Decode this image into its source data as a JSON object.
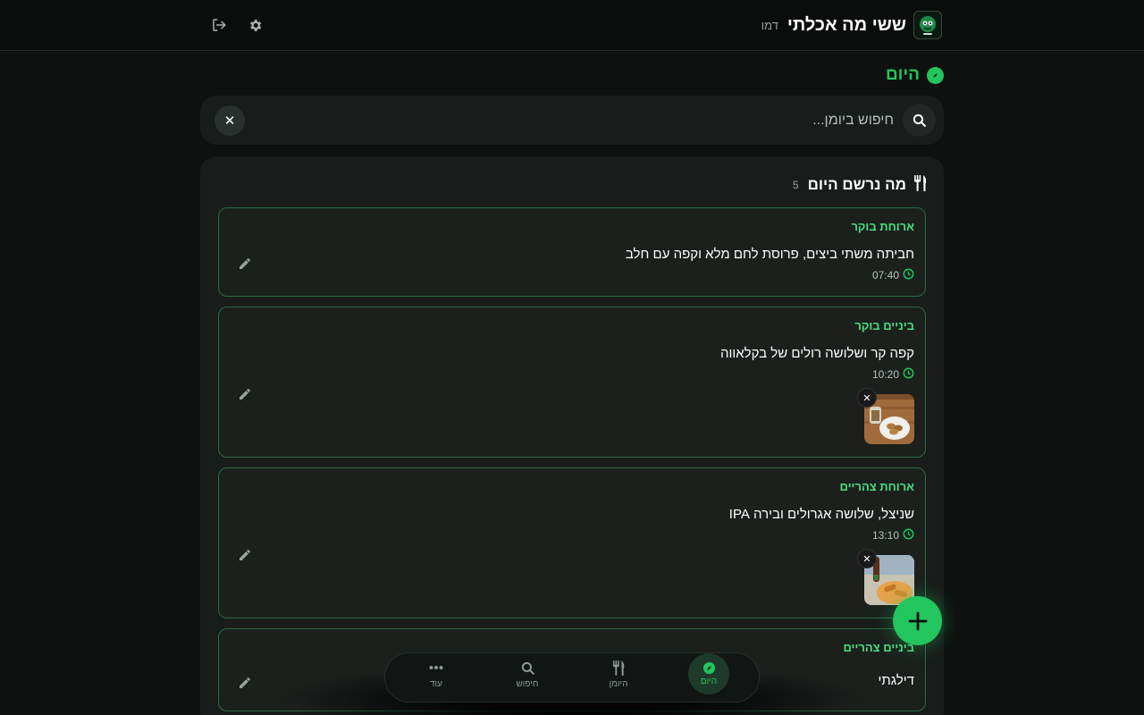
{
  "app": {
    "title": "ששי מה אכלתי",
    "mode_badge": "דמו"
  },
  "colors": {
    "accent": "#22c55e",
    "background": "#0e1110",
    "panel": "#181c1a",
    "card_border": "#2a6b44"
  },
  "header_icons": [
    "settings-gear-icon",
    "logout-icon"
  ],
  "section": {
    "title": "היום"
  },
  "search": {
    "placeholder": "חיפוש ביומן...",
    "value": "",
    "clear_label": "✕"
  },
  "log": {
    "title": "מה נרשם היום",
    "count": "5",
    "entries": [
      {
        "type": "ארוחת בוקר",
        "description": "חביתה משתי ביצים, פרוסת לחם מלא וקפה עם חלב",
        "time": "07:40",
        "has_photo": false
      },
      {
        "type": "ביניים בוקר",
        "description": "קפה קר ושלושה רולים של בקלאווה",
        "time": "10:20",
        "has_photo": true
      },
      {
        "type": "ארוחת צהריים",
        "description": "שניצל, שלושה אגרולים ובירה IPA",
        "time": "13:10",
        "has_photo": true
      },
      {
        "type": "ביניים צהריים",
        "description": "דילגתי",
        "time": "",
        "has_photo": false
      }
    ]
  },
  "bottom_nav": {
    "items": [
      {
        "label": "היום",
        "icon": "compass-icon",
        "active": true
      },
      {
        "label": "היומן",
        "icon": "utensils-icon",
        "active": false
      },
      {
        "label": "חיפוש",
        "icon": "search-icon",
        "active": false
      },
      {
        "label": "עוד",
        "icon": "more-icon",
        "active": false
      }
    ]
  }
}
